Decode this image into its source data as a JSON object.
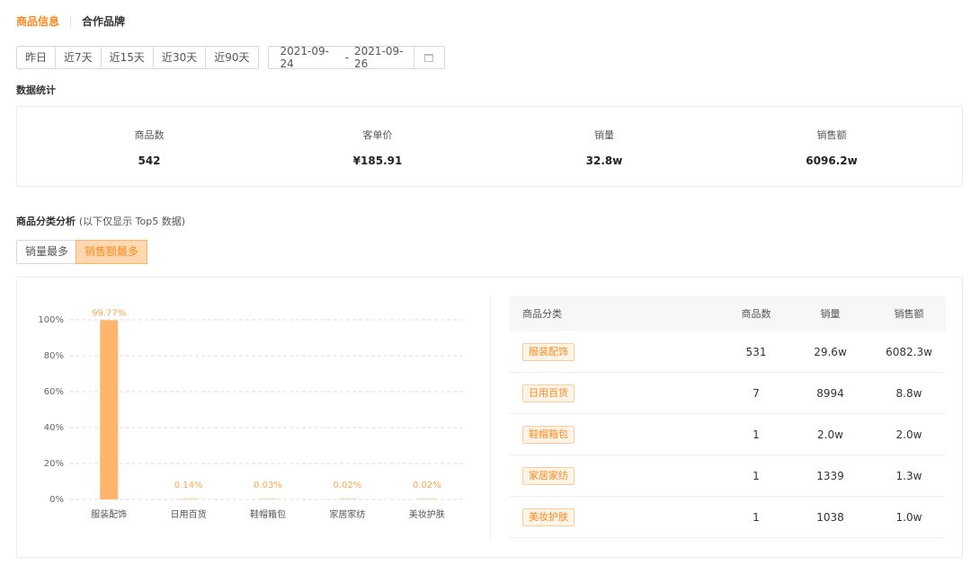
{
  "tabs": [
    {
      "label": "商品信息",
      "active": true
    },
    {
      "label": "合作品牌",
      "active": false
    }
  ],
  "date_ranges": [
    "昨日",
    "近7天",
    "近15天",
    "近30天",
    "近90天"
  ],
  "date_picker": {
    "start": "2021-09-24",
    "separator": "-",
    "end": "2021-09-26"
  },
  "stats_title": "数据统计",
  "stats": [
    {
      "label": "商品数",
      "value": "542"
    },
    {
      "label": "客单价",
      "value": "¥185.91"
    },
    {
      "label": "销量",
      "value": "32.8w"
    },
    {
      "label": "销售额",
      "value": "6096.2w"
    }
  ],
  "category_title": "商品分类分析",
  "category_hint": "(以下仅显示 Top5 数据)",
  "sort_buttons": [
    {
      "label": "销量最多",
      "active": false
    },
    {
      "label": "销售额最多",
      "active": true
    }
  ],
  "colors": {
    "accent": "#ff8a1f",
    "bar": "#ffb56b",
    "label": "#ffa64d"
  },
  "chart_data": {
    "type": "bar",
    "categories": [
      "服装配饰",
      "日用百货",
      "鞋帽箱包",
      "家居家纺",
      "美妆护肤"
    ],
    "values": [
      99.77,
      0.14,
      0.03,
      0.02,
      0.02
    ],
    "data_labels": [
      "99.77%",
      "0.14%",
      "0.03%",
      "0.02%",
      "0.02%"
    ],
    "y_ticks": [
      "0%",
      "20%",
      "40%",
      "60%",
      "80%",
      "100%"
    ],
    "ylim": [
      0,
      100
    ],
    "grid": true
  },
  "table": {
    "headers": [
      "商品分类",
      "商品数",
      "销量",
      "销售额"
    ],
    "rows": [
      {
        "category": "服装配饰",
        "count": "531",
        "sales": "29.6w",
        "revenue": "6082.3w"
      },
      {
        "category": "日用百货",
        "count": "7",
        "sales": "8994",
        "revenue": "8.8w"
      },
      {
        "category": "鞋帽箱包",
        "count": "1",
        "sales": "2.0w",
        "revenue": "2.0w"
      },
      {
        "category": "家居家纺",
        "count": "1",
        "sales": "1339",
        "revenue": "1.3w"
      },
      {
        "category": "美妆护肤",
        "count": "1",
        "sales": "1038",
        "revenue": "1.0w"
      }
    ]
  }
}
